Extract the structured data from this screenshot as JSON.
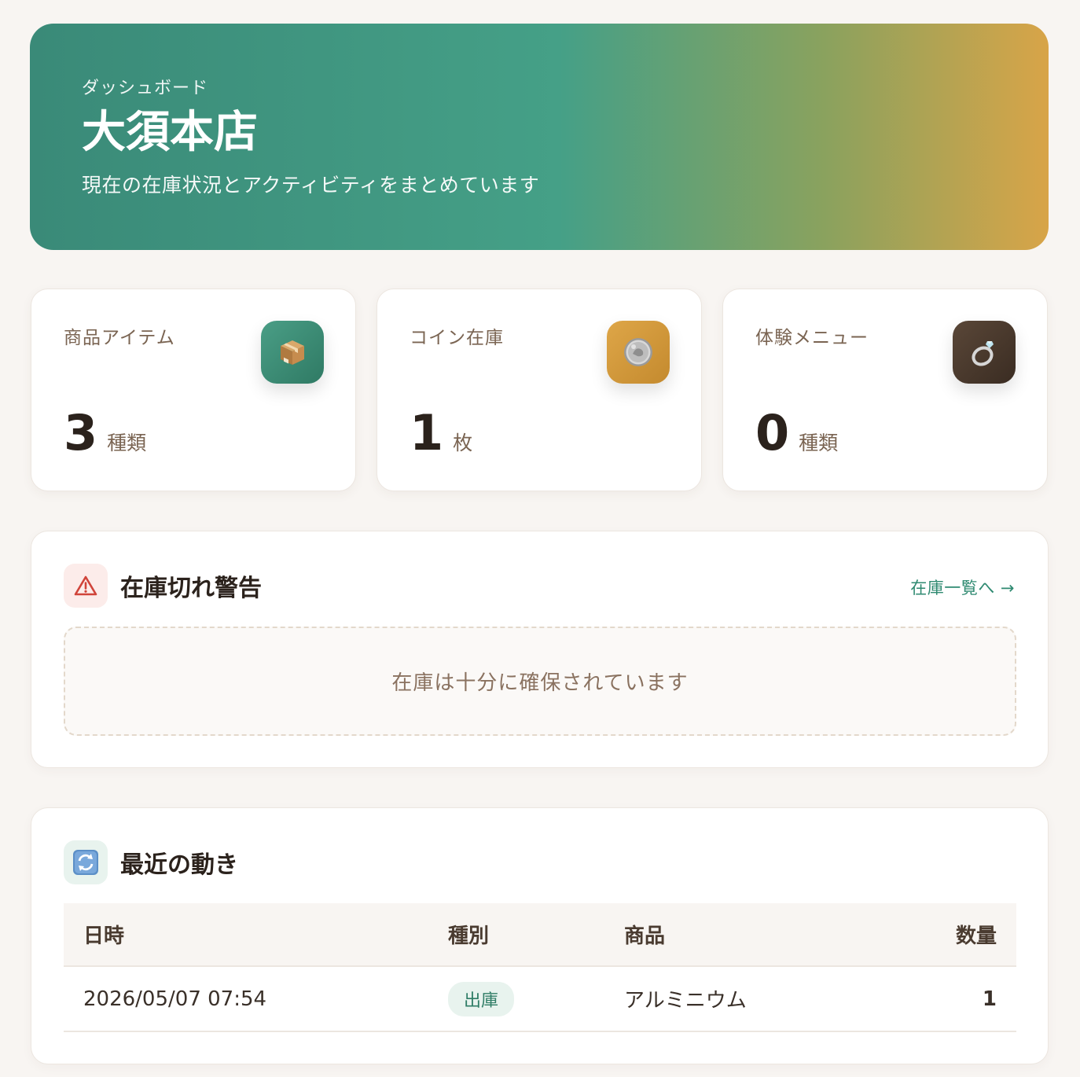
{
  "hero": {
    "eyebrow": "ダッシュボード",
    "title": "大須本店",
    "subtitle": "現在の在庫状況とアクティビティをまとめています"
  },
  "stats": [
    {
      "label": "商品アイテム",
      "value": "3",
      "unit": "種類",
      "icon": "package-icon",
      "icon_bg": "#3f8f78"
    },
    {
      "label": "コイン在庫",
      "value": "1",
      "unit": "枚",
      "icon": "coin-icon",
      "icon_bg": "#d29a3a"
    },
    {
      "label": "体験メニュー",
      "value": "0",
      "unit": "種類",
      "icon": "ring-icon",
      "icon_bg": "#4a3a2e"
    }
  ],
  "stock_alert": {
    "title": "在庫切れ警告",
    "link": "在庫一覧へ →",
    "empty_message": "在庫は十分に確保されています",
    "icon": "warning-icon"
  },
  "recent": {
    "title": "最近の動き",
    "icon": "refresh-icon",
    "columns": [
      "日時",
      "種別",
      "商品",
      "数量"
    ],
    "rows": [
      {
        "datetime": "2026/05/07 07:54",
        "type": "出庫",
        "product": "アルミニウム",
        "qty": "1"
      }
    ]
  },
  "colors": {
    "accent": "#2f8a71",
    "hero_start": "#3a8a78",
    "hero_end": "#d8a448",
    "alert": "#d0443a"
  }
}
